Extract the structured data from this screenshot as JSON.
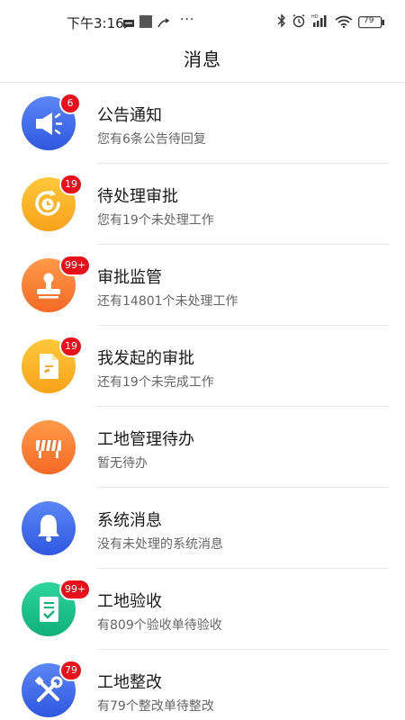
{
  "status_bar": {
    "time": "下午3:16",
    "battery": "79"
  },
  "header": {
    "title": "消息"
  },
  "items": [
    {
      "title": "公告通知",
      "subtitle": "您有6条公告待回复",
      "badge": "6",
      "icon": "megaphone-icon",
      "color_top": "#5a86f5",
      "color_bottom": "#2f58e0"
    },
    {
      "title": "待处理审批",
      "subtitle": "您有19个未处理工作",
      "badge": "19",
      "icon": "clock-refresh-icon",
      "color_top": "#ffc83a",
      "color_bottom": "#f7a21a"
    },
    {
      "title": "审批监管",
      "subtitle": "还有14801个未处理工作",
      "badge": "99+",
      "icon": "stamp-icon",
      "color_top": "#ff9a4a",
      "color_bottom": "#f46a26"
    },
    {
      "title": "我发起的审批",
      "subtitle": "还有19个未完成工作",
      "badge": "19",
      "icon": "document-icon",
      "color_top": "#ffc83a",
      "color_bottom": "#f7a21a"
    },
    {
      "title": "工地管理待办",
      "subtitle": "暂无待办",
      "badge": "",
      "icon": "barrier-icon",
      "color_top": "#ff9a4a",
      "color_bottom": "#f46a26"
    },
    {
      "title": "系统消息",
      "subtitle": "没有未处理的系统消息",
      "badge": "",
      "icon": "bell-icon",
      "color_top": "#5a86f5",
      "color_bottom": "#2f58e0"
    },
    {
      "title": "工地验收",
      "subtitle": "有809个验收单待验收",
      "badge": "99+",
      "icon": "checklist-icon",
      "color_top": "#2fd49c",
      "color_bottom": "#10b07a"
    },
    {
      "title": "工地整改",
      "subtitle": "有79个整改单待整改",
      "badge": "79",
      "icon": "tools-icon",
      "color_top": "#5a86f5",
      "color_bottom": "#2f58e0"
    }
  ]
}
